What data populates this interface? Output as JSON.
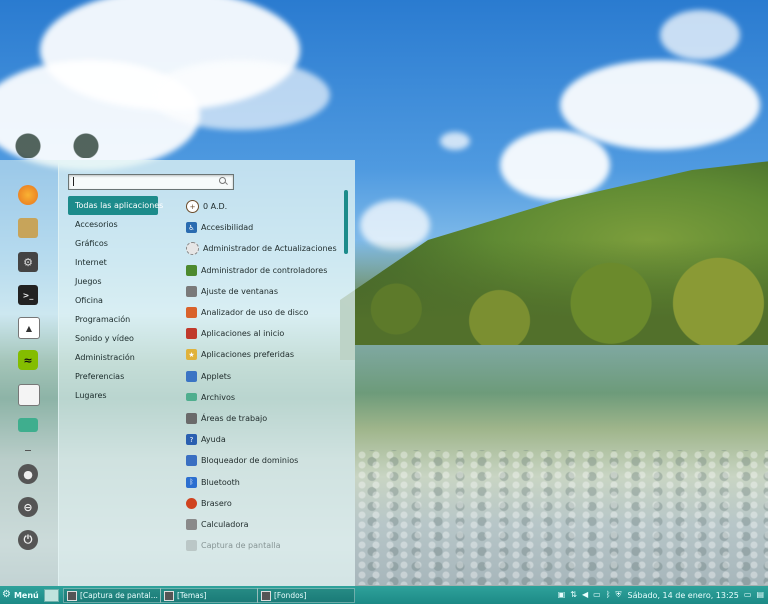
{
  "favorites": [
    {
      "icon": "firefox-icon",
      "color": "#e8741e"
    },
    {
      "icon": "package-installer-icon",
      "color": "#c7a45a"
    },
    {
      "icon": "system-settings-icon",
      "color": "#444444"
    },
    {
      "icon": "terminal-icon",
      "color": "#222222"
    },
    {
      "icon": "software-manager-icon",
      "color": "#2d7dbb"
    },
    {
      "icon": "spotify-icon",
      "color": "#84bd00"
    },
    {
      "icon": "text-editor-icon",
      "color": "#f4f4f4"
    },
    {
      "icon": "files-icon",
      "color": "#3fae8e"
    },
    {
      "icon": "lock-screen-icon",
      "color": "#555555"
    },
    {
      "icon": "logout-icon",
      "color": "#555555"
    },
    {
      "icon": "shutdown-icon",
      "color": "#555555"
    }
  ],
  "search": {
    "value": ""
  },
  "categories": [
    "Todas las aplicaciones",
    "Accesorios",
    "Gráficos",
    "Internet",
    "Juegos",
    "Oficina",
    "Programación",
    "Sonido y vídeo",
    "Administración",
    "Preferencias",
    "Lugares"
  ],
  "active_category": "Todas las aplicaciones",
  "apps": [
    {
      "label": "0 A.D.",
      "icon": "0ad-icon",
      "color": "#6b4b2a"
    },
    {
      "label": "Accesibilidad",
      "icon": "accessibility-icon",
      "color": "#2a6bb0"
    },
    {
      "label": "Administrador de Actualizaciones",
      "icon": "update-manager-icon",
      "color": "#cfcfcf"
    },
    {
      "label": "Administrador de controladores",
      "icon": "driver-manager-icon",
      "color": "#4d8a2e"
    },
    {
      "label": "Ajuste de ventanas",
      "icon": "window-tiling-icon",
      "color": "#7a7a7a"
    },
    {
      "label": "Analizador de uso de disco",
      "icon": "disk-usage-icon",
      "color": "#d9622b"
    },
    {
      "label": "Aplicaciones al inicio",
      "icon": "startup-apps-icon",
      "color": "#c0392b"
    },
    {
      "label": "Aplicaciones preferidas",
      "icon": "preferred-apps-icon",
      "color": "#e0b23a"
    },
    {
      "label": "Applets",
      "icon": "applets-icon",
      "color": "#3b74c4"
    },
    {
      "label": "Archivos",
      "icon": "folder-icon",
      "color": "#4fae8e"
    },
    {
      "label": "Áreas de trabajo",
      "icon": "workspaces-icon",
      "color": "#6a6a6a"
    },
    {
      "label": "Ayuda",
      "icon": "help-icon",
      "color": "#2a5fb0"
    },
    {
      "label": "Bloqueador de dominios",
      "icon": "domain-blocker-icon",
      "color": "#3a6fc2"
    },
    {
      "label": "Bluetooth",
      "icon": "bluetooth-icon",
      "color": "#2c6fd0"
    },
    {
      "label": "Brasero",
      "icon": "brasero-icon",
      "color": "#d0431f"
    },
    {
      "label": "Calculadora",
      "icon": "calculator-icon",
      "color": "#8a8a8a"
    },
    {
      "label": "Captura de pantalla",
      "icon": "screenshot-icon",
      "color": "#9aa0a0"
    }
  ],
  "taskbar": {
    "menu_label": "Menú",
    "tasks": [
      "[Captura de pantal...",
      "[Temas]",
      "[Fondos]"
    ],
    "clock": "Sábado, 14 de enero, 13:25"
  }
}
